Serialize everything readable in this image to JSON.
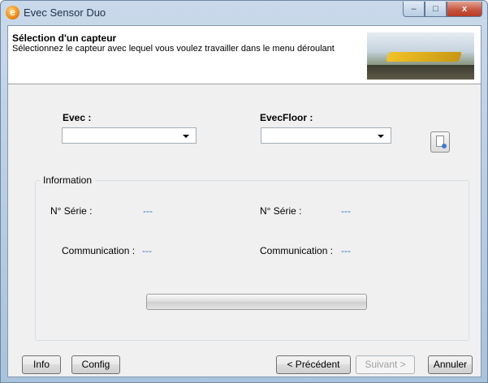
{
  "window": {
    "title": "Evec Sensor Duo",
    "app_icon_letter": "e",
    "buttons": {
      "minimize": "–",
      "maximize": "□",
      "close": "x"
    }
  },
  "header": {
    "title": "Sélection d'un capteur",
    "subtitle": "Sélectionnez le capteur avec lequel vous voulez travailler dans le menu déroulant"
  },
  "sensors": {
    "left": {
      "label": "Evec :",
      "value": ""
    },
    "right": {
      "label": "EvecFloor :",
      "value": ""
    }
  },
  "information": {
    "legend": "Information",
    "left": {
      "serial_label": "N° Série :",
      "serial_value": "---",
      "comm_label": "Communication :",
      "comm_value": "---"
    },
    "right": {
      "serial_label": "N° Série :",
      "serial_value": "---",
      "comm_label": "Communication :",
      "comm_value": "---"
    }
  },
  "progress": {
    "value": 0
  },
  "footer": {
    "info": "Info",
    "config": "Config",
    "previous": "< Précédent",
    "next": "Suivant >",
    "cancel": "Annuler"
  },
  "colors": {
    "value_text": "#3a6fc2",
    "title_bar": "#c9d9ea"
  }
}
